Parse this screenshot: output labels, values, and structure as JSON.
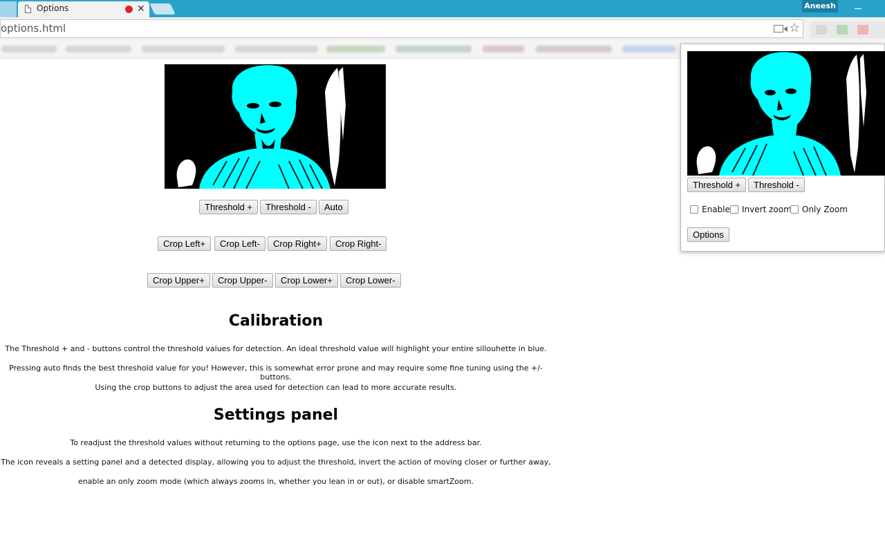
{
  "browser": {
    "tab_title": "Options",
    "profile_name": "Aneesh",
    "url": "options.html",
    "record_color": "#dd2222"
  },
  "controls": {
    "threshold_plus": "Threshold +",
    "threshold_minus": "Threshold -",
    "auto": "Auto",
    "crop_left_plus": "Crop Left+",
    "crop_left_minus": "Crop Left-",
    "crop_right_plus": "Crop Right+",
    "crop_right_minus": "Crop Right-",
    "crop_upper_plus": "Crop Upper+",
    "crop_upper_minus": "Crop Upper-",
    "crop_lower_plus": "Crop Lower+",
    "crop_lower_minus": "Crop Lower-"
  },
  "calibration": {
    "heading": "Calibration",
    "paragraphs": [
      "The Threshold + and - buttons control the threshold values for detection. An ideal threshold value will highlight your entire sillouhette in blue.",
      "Pressing auto finds the best threshold value for you! However, this is somewhat error prone and may require some fine tuning using the +/- buttons.",
      "Using the crop buttons to adjust the area used for detection can lead to more accurate results."
    ]
  },
  "settings_panel": {
    "heading": "Settings panel",
    "paragraphs": [
      "To readjust the threshold values without returning to the options page, use the icon next to the address bar.",
      "The icon reveals a setting panel and a detected display, allowing you to adjust the threshold, invert the action of moving closer or further away,",
      "enable an only zoom mode (which always zooms in, whether you lean in or out), or disable smartZoom."
    ]
  },
  "popup": {
    "threshold_plus": "Threshold +",
    "threshold_minus": "Threshold -",
    "enable_label": "Enable",
    "invert_zoom_label": "Invert zoom",
    "only_zoom_label": "Only Zoom",
    "options_button": "Options"
  },
  "colors": {
    "silhouette": "#00ffff",
    "background": "#000000",
    "title_bar": "#2aa3cc"
  }
}
